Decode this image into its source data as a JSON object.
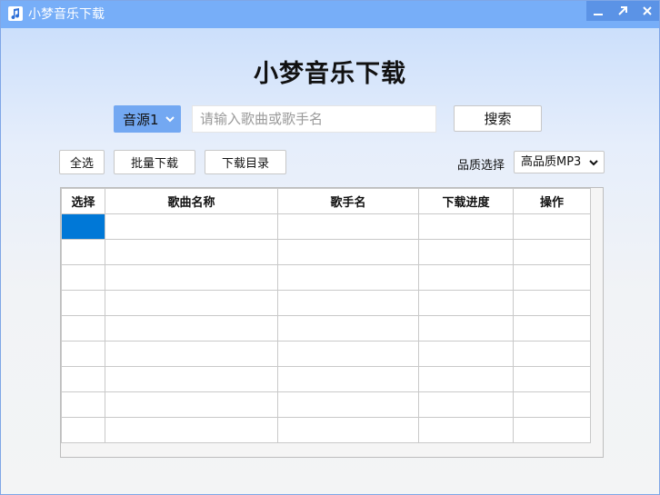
{
  "window": {
    "title": "小梦音乐下载"
  },
  "header": {
    "title": "小梦音乐下载"
  },
  "search": {
    "source_value": "音源1",
    "placeholder": "请输入歌曲或歌手名",
    "value": "",
    "button_label": "搜索"
  },
  "toolbar": {
    "select_all_label": "全选",
    "batch_download_label": "批量下载",
    "download_dir_label": "下载目录",
    "quality_label": "品质选择",
    "quality_value": "高品质MP3"
  },
  "table": {
    "columns": [
      "选择",
      "歌曲名称",
      "歌手名",
      "下载进度",
      "操作"
    ],
    "rows": [
      [
        "",
        "",
        "",
        "",
        ""
      ],
      [
        "",
        "",
        "",
        "",
        ""
      ],
      [
        "",
        "",
        "",
        "",
        ""
      ],
      [
        "",
        "",
        "",
        "",
        ""
      ],
      [
        "",
        "",
        "",
        "",
        ""
      ],
      [
        "",
        "",
        "",
        "",
        ""
      ],
      [
        "",
        "",
        "",
        "",
        ""
      ],
      [
        "",
        "",
        "",
        "",
        ""
      ],
      [
        "",
        "",
        "",
        "",
        ""
      ]
    ]
  },
  "icons": {
    "app": "music-note-icon",
    "minimize": "minimize-icon",
    "maximize": "maximize-icon",
    "close": "close-icon",
    "dropdown": "chevron-down-icon"
  },
  "colors": {
    "titlebar": "#77aef8",
    "accent": "#73a8f2",
    "selection": "#0078d7"
  }
}
